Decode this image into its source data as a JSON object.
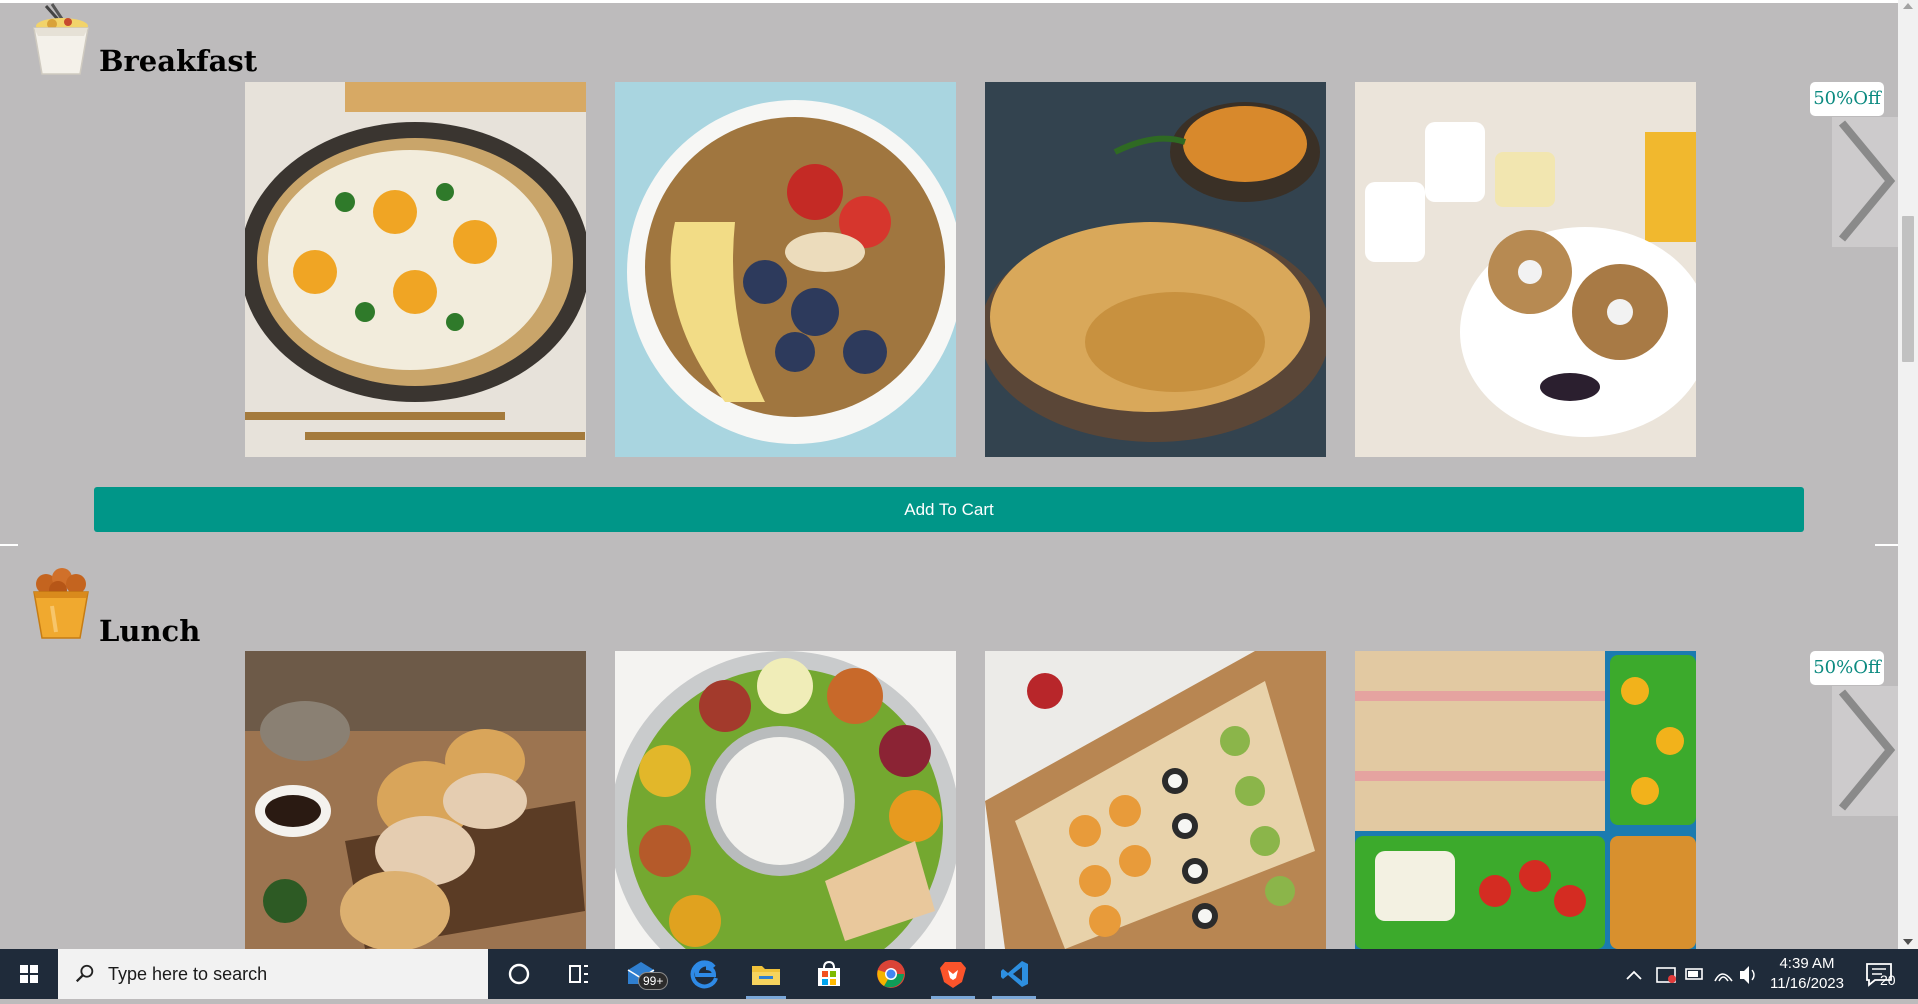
{
  "sections": [
    {
      "title": "Breakfast",
      "icon": "noodle-box-icon",
      "discount": "50%Off",
      "foods": [
        "eggs-skillet-image",
        "fruit-bowl-image",
        "paratha-dal-image",
        "bagels-coffee-image"
      ]
    },
    {
      "title": "Lunch",
      "icon": "fried-chicken-bucket-icon",
      "discount": "50%Off",
      "foods": [
        "sliders-image",
        "thali-image",
        "sushi-wraps-image",
        "lunchbox-image"
      ]
    }
  ],
  "cart": {
    "label": "Add To Cart"
  },
  "taskbar": {
    "search_placeholder": "Type here to search",
    "mail_badge": "99+",
    "time": "4:39 AM",
    "date": "11/16/2023",
    "notification_count": "20"
  },
  "colors": {
    "page_bg": "#bdbbbc",
    "accent": "#009688",
    "discount_text": "#0b8a80",
    "taskbar_bg": "#1f2b3a"
  }
}
